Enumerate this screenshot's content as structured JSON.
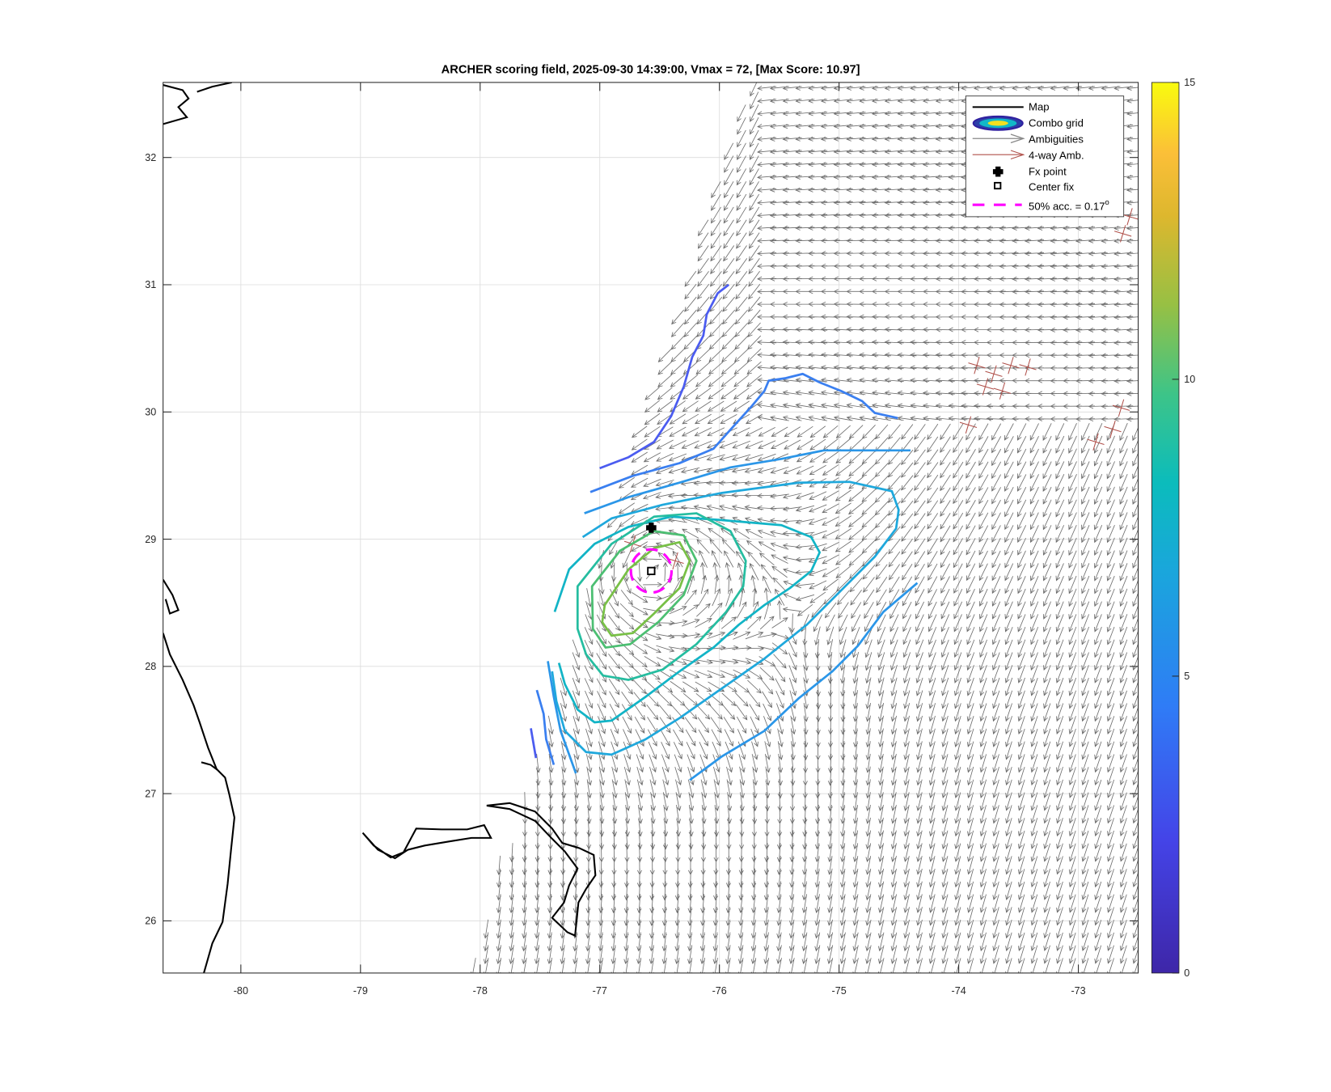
{
  "chart_data": {
    "type": "contour",
    "title": "ARCHER scoring field, 2025-09-30 14:39:00, Vmax = 72, [Max Score: 10.97]",
    "xlim": [
      -80.65,
      -72.5
    ],
    "ylim": [
      25.59,
      32.59
    ],
    "xticks": [
      "-80",
      "-79",
      "-78",
      "-77",
      "-76",
      "-75",
      "-74",
      "-73"
    ],
    "yticks": [
      "26",
      "27",
      "28",
      "29",
      "30",
      "31",
      "32"
    ],
    "grid": true,
    "colorbar": {
      "range": [
        0,
        15
      ],
      "ticks": [
        "0",
        "5",
        "10",
        "15"
      ],
      "colormap": "parula"
    },
    "max_score": 10.97,
    "fx_point": {
      "lon": -76.57,
      "lat": 29.09
    },
    "center_fix": {
      "lon": -76.57,
      "lat": 28.75
    },
    "acc50_radius_deg": 0.17,
    "contour_levels_approx": [
      3.5,
      4.5,
      5.5,
      6.5,
      7.5,
      8.5,
      9.5,
      10
    ],
    "legend": {
      "placement": "top-right",
      "items": [
        "Map",
        "Combo grid",
        "Ambiguities",
        "4-way Amb.",
        "Fx point",
        "Center fix",
        "50% acc. = 0.17"
      ],
      "degree_mark": "o"
    },
    "colors": {
      "map": "#000000",
      "ambiguities": "#6e6e6e",
      "four_way": "#b0504a",
      "acc50": "#ff00ff"
    }
  }
}
